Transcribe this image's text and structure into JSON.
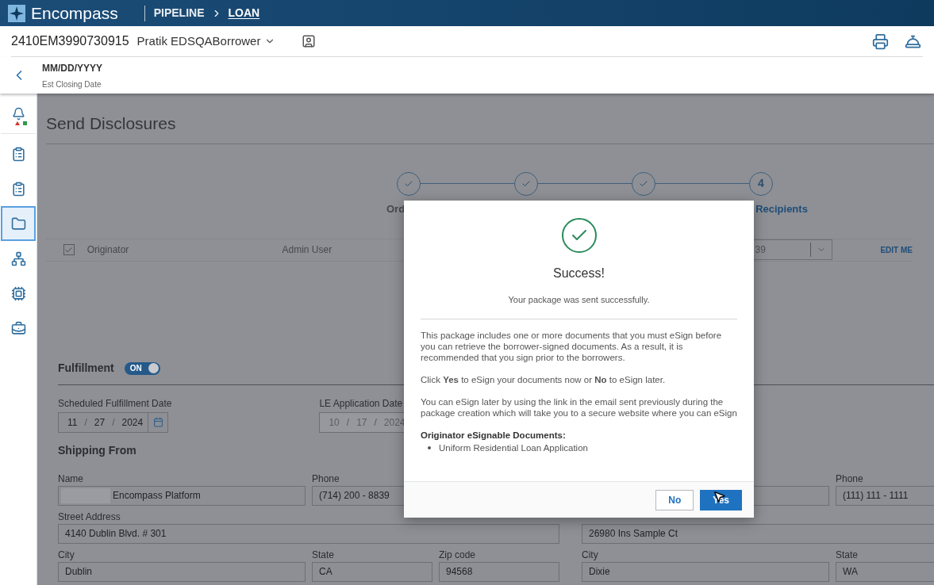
{
  "app_bar": {
    "brand": "Encompass",
    "breadcrumb": [
      {
        "label": "PIPELINE",
        "selected": false
      },
      {
        "label": "LOAN",
        "selected": true
      }
    ]
  },
  "loan_header": {
    "loan_number": "2410EM3990730915",
    "borrower": "Pratik EDSQABorrower",
    "date_value": "MM/DD/YYYY",
    "date_label": "Est Closing Date"
  },
  "sidebar": {
    "items": [
      {
        "kind": "alerts",
        "selected": false
      },
      {
        "kind": "list",
        "selected": false
      },
      {
        "kind": "list",
        "selected": false
      },
      {
        "kind": "folder",
        "selected": true
      },
      {
        "kind": "network",
        "selected": false
      },
      {
        "kind": "chip",
        "selected": false
      },
      {
        "kind": "briefcase",
        "selected": false
      }
    ]
  },
  "page": {
    "title": "Send Disclosures",
    "steps": [
      {
        "done": true,
        "label": "Ord"
      },
      {
        "done": true
      },
      {
        "done": true
      },
      {
        "done": false,
        "number": "4",
        "label": "Recipients"
      }
    ],
    "recipients": [
      {
        "checked": true,
        "role": "Originator",
        "name": "Admin User",
        "dropdown_value": "39",
        "action": "EDIT ME"
      }
    ],
    "fulfillment": {
      "label": "Fulfillment",
      "toggle": {
        "on": true,
        "text": "ON"
      },
      "dates": [
        {
          "label": "Scheduled Fulfillment Date",
          "month": "11",
          "day": "27",
          "year": "2024",
          "separator": "/",
          "calendar": true,
          "disabled": false
        },
        {
          "label": "LE Application Date",
          "month": "10",
          "day": "17",
          "year": "2024",
          "separator": "/",
          "calendar": false,
          "disabled": true
        }
      ]
    },
    "shipping_from": {
      "title": "Shipping From",
      "name": {
        "label": "Name",
        "value": "Encompass Platform",
        "redacted": true
      },
      "phone": {
        "label": "Phone",
        "value": "(714) 200 - 8839"
      },
      "street": {
        "label": "Street Address",
        "value": "4140 Dublin Blvd. # 301"
      },
      "city": {
        "label": "City",
        "value": "Dublin"
      },
      "state": {
        "label": "State",
        "value": "CA"
      },
      "zip": {
        "label": "Zip code",
        "value": "94568"
      }
    },
    "column_2": {
      "phone": {
        "label": "Phone",
        "value": "(111) 111 - 1111"
      },
      "street": {
        "value": "26980 Ins Sample Ct"
      },
      "city": {
        "label": "City",
        "value": "Dixie"
      },
      "state": {
        "label": "State",
        "value": "WA"
      }
    }
  },
  "dialog": {
    "title": "Success!",
    "subtitle": "Your package was sent successfully.",
    "paragraphs": [
      "This package includes one or more documents that you must eSign before you can retrieve the borrower-signed documents. As a result, it is recommended that you sign prior to the borrowers.",
      "Click **Yes** to eSign your documents now or **No** to eSign later.",
      "You can eSign later by using the link in the email sent previously during the package creation which will take you to a secure website where you can eSign"
    ],
    "list_title": "Originator eSignable Documents:",
    "documents": [
      "Uniform Residential Loan Application"
    ],
    "buttons": [
      {
        "label": "No",
        "kind": "secondary"
      },
      {
        "label": "Yes",
        "kind": "primary"
      }
    ]
  }
}
